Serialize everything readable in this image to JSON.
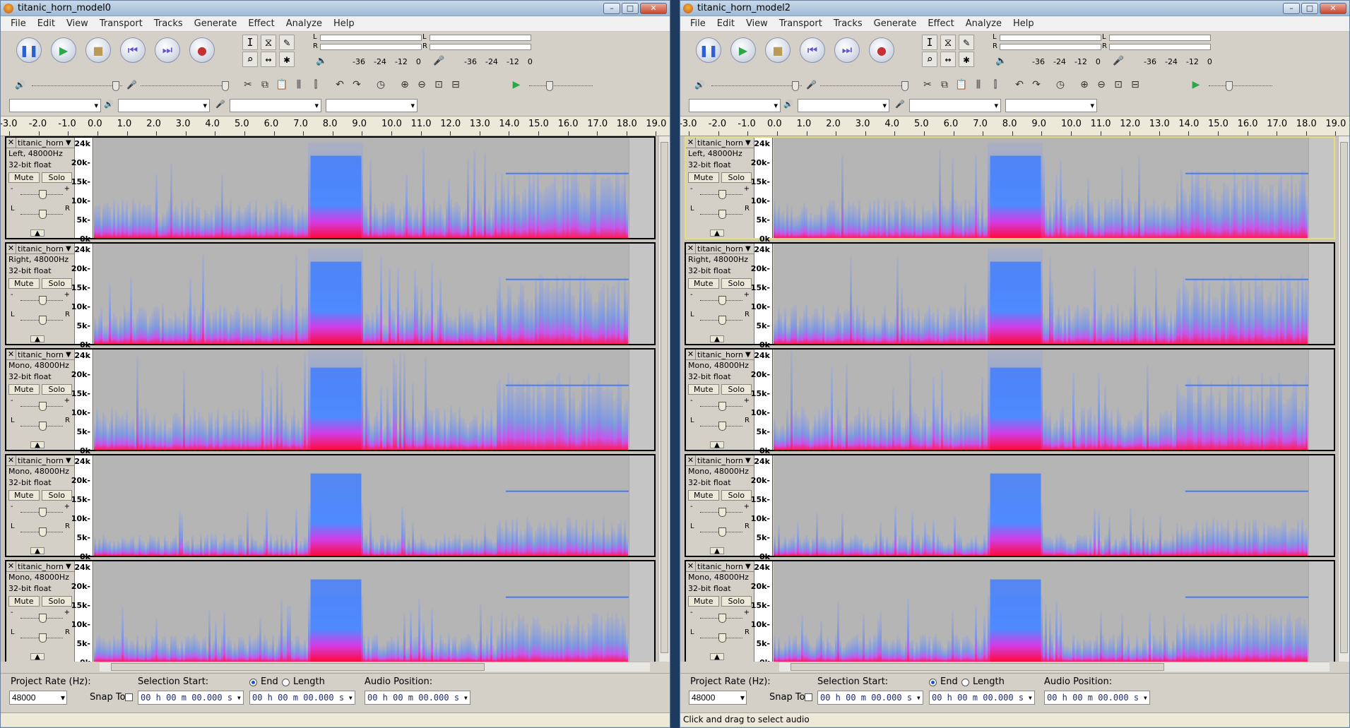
{
  "windows": [
    {
      "title": "titanic_horn_model0",
      "status_text": "",
      "selected_track": -1
    },
    {
      "title": "titanic_horn_model2",
      "status_text": "Click and drag to select audio",
      "selected_track": 0
    }
  ],
  "caption": {
    "minimize": "–",
    "maximize": "□",
    "close": "✕"
  },
  "menu": [
    "File",
    "Edit",
    "View",
    "Transport",
    "Tracks",
    "Generate",
    "Effect",
    "Analyze",
    "Help"
  ],
  "transport_icons": [
    "pause-icon",
    "play-icon",
    "stop-icon",
    "skip-start-icon",
    "skip-end-icon",
    "record-icon"
  ],
  "tools": [
    "selection-tool-icon",
    "envelope-tool-icon",
    "draw-tool-icon",
    "zoom-tool-icon",
    "timeshift-tool-icon",
    "multi-tool-icon"
  ],
  "meter": {
    "left_label": "L",
    "right_label": "R",
    "scale": [
      "-36",
      "-24",
      "-12",
      "0"
    ]
  },
  "ruler_ticks": [
    "-3.0",
    "-2.0",
    "-1.0",
    "0.0",
    "1.0",
    "2.0",
    "3.0",
    "4.0",
    "5.0",
    "6.0",
    "7.0",
    "8.0",
    "9.0",
    "10.0",
    "11.0",
    "12.0",
    "13.0",
    "14.0",
    "15.0",
    "16.0",
    "17.0",
    "18.0",
    "19.0"
  ],
  "freq_labels": [
    "24k",
    "20k-",
    "15k-",
    "10k-",
    "5k-",
    "0k"
  ],
  "tracks": [
    {
      "name": "titanic_horn",
      "format": "Left, 48000Hz",
      "bits": "32-bit float",
      "level": 1.0
    },
    {
      "name": "titanic_horn",
      "format": "Right, 48000Hz",
      "bits": "32-bit float",
      "level": 1.0
    },
    {
      "name": "titanic_horn",
      "format": "Mono, 48000Hz",
      "bits": "32-bit float",
      "level": 1.1
    },
    {
      "name": "titanic_horn",
      "format": "Mono, 48000Hz",
      "bits": "32-bit float",
      "level": 0.55
    },
    {
      "name": "titanic_horn",
      "format": "Mono, 48000Hz",
      "bits": "32-bit float",
      "level": 0.7
    }
  ],
  "track_buttons": {
    "mute": "Mute",
    "solo": "Solo",
    "pan_l": "L",
    "pan_r": "R",
    "gain_minus": "-",
    "gain_plus": "+"
  },
  "selection_bar": {
    "project_rate_label": "Project Rate (Hz):",
    "project_rate": "48000",
    "snap_to": "Snap To",
    "selection_start_label": "Selection Start:",
    "end_label": "End",
    "length_label": "Length",
    "audio_position_label": "Audio Position:",
    "time_value": "00 h 00 m 00.000 s"
  }
}
